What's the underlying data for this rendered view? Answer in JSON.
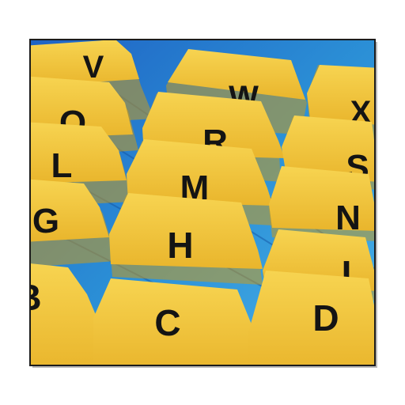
{
  "image": {
    "subject": "yellow alphabetical file folder index tabs",
    "colors": {
      "background": "#ffffff",
      "blue_tray": "#2b8fd6",
      "tab_yellow": "#f3c53a",
      "tab_shadow": "#c99a1e",
      "letter": "#141414"
    }
  },
  "tabs": [
    {
      "letter": "V"
    },
    {
      "letter": "W"
    },
    {
      "letter": "X"
    },
    {
      "letter": "Q"
    },
    {
      "letter": "R"
    },
    {
      "letter": "S"
    },
    {
      "letter": "L"
    },
    {
      "letter": "M"
    },
    {
      "letter": "N"
    },
    {
      "letter": "G"
    },
    {
      "letter": "H"
    },
    {
      "letter": "I"
    },
    {
      "letter": "B"
    },
    {
      "letter": "C"
    },
    {
      "letter": "D"
    }
  ]
}
